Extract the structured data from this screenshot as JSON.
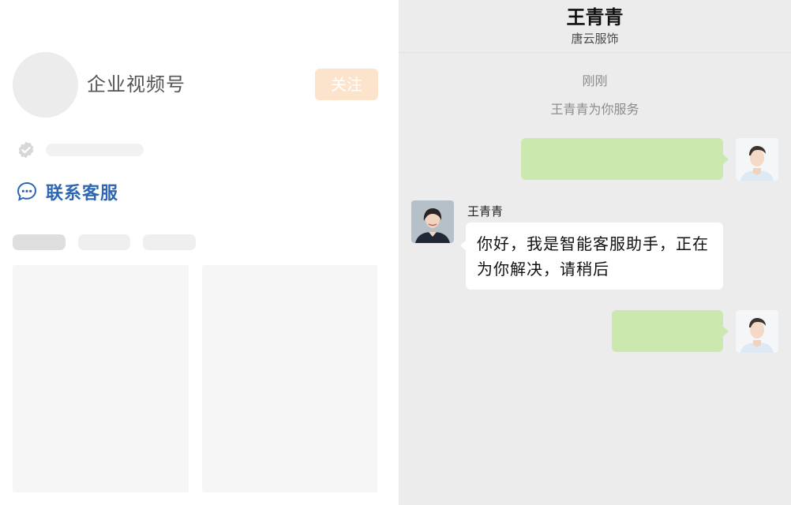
{
  "profile": {
    "channel_name": "企业视频号",
    "follow_label": "关注",
    "contact_label": "联系客服",
    "accent_color": "#2d67b3",
    "follow_color": "#fce3cc"
  },
  "chat": {
    "agent_name": "王青青",
    "company": "唐云服饰",
    "time_label": "刚刚",
    "service_notice": "王青青为你服务",
    "messages": [
      {
        "from": "user",
        "text": ""
      },
      {
        "from": "agent",
        "sender": "王青青",
        "text": "你好，我是智能客服助手，正在为你解决，请稍后"
      },
      {
        "from": "user",
        "text": ""
      }
    ],
    "outgoing_bubble_color": "#cbe8ae"
  }
}
